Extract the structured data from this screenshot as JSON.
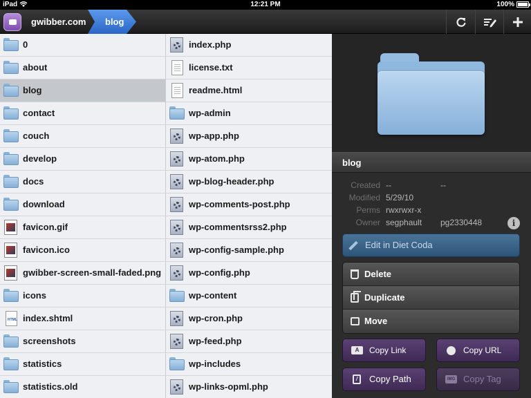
{
  "status": {
    "device": "iPad",
    "time": "12:21 PM",
    "battery": "100%",
    "battery_level": 1.0
  },
  "breadcrumb": {
    "site": "gwibber.com",
    "folder": "blog"
  },
  "toolbar": {
    "icons": [
      "refresh-icon",
      "edit-list-icon",
      "add-icon"
    ]
  },
  "files_col1": [
    {
      "name": "0",
      "type": "folder"
    },
    {
      "name": "about",
      "type": "folder"
    },
    {
      "name": "blog",
      "type": "folder",
      "selected": true
    },
    {
      "name": "contact",
      "type": "folder"
    },
    {
      "name": "couch",
      "type": "folder"
    },
    {
      "name": "develop",
      "type": "folder"
    },
    {
      "name": "docs",
      "type": "folder"
    },
    {
      "name": "download",
      "type": "folder"
    },
    {
      "name": "favicon.gif",
      "type": "image"
    },
    {
      "name": "favicon.ico",
      "type": "image"
    },
    {
      "name": "gwibber-screen-small-faded.png",
      "type": "image"
    },
    {
      "name": "icons",
      "type": "folder"
    },
    {
      "name": "index.shtml",
      "type": "html"
    },
    {
      "name": "screenshots",
      "type": "folder"
    },
    {
      "name": "statistics",
      "type": "folder"
    },
    {
      "name": "statistics.old",
      "type": "folder"
    }
  ],
  "files_col2": [
    {
      "name": "index.php",
      "type": "php"
    },
    {
      "name": "license.txt",
      "type": "doc"
    },
    {
      "name": "readme.html",
      "type": "doc"
    },
    {
      "name": "wp-admin",
      "type": "folder"
    },
    {
      "name": "wp-app.php",
      "type": "php"
    },
    {
      "name": "wp-atom.php",
      "type": "php"
    },
    {
      "name": "wp-blog-header.php",
      "type": "php"
    },
    {
      "name": "wp-comments-post.php",
      "type": "php"
    },
    {
      "name": "wp-commentsrss2.php",
      "type": "php"
    },
    {
      "name": "wp-config-sample.php",
      "type": "php"
    },
    {
      "name": "wp-config.php",
      "type": "php"
    },
    {
      "name": "wp-content",
      "type": "folder"
    },
    {
      "name": "wp-cron.php",
      "type": "php"
    },
    {
      "name": "wp-feed.php",
      "type": "php"
    },
    {
      "name": "wp-includes",
      "type": "folder"
    },
    {
      "name": "wp-links-opml.php",
      "type": "php"
    }
  ],
  "inspector": {
    "name": "blog",
    "meta": [
      {
        "label": "Created",
        "value": "--",
        "value2": "--"
      },
      {
        "label": "Modified",
        "value": "5/29/10",
        "value2": ""
      },
      {
        "label": "Perms",
        "value": "rwxrwxr-x",
        "value2": ""
      },
      {
        "label": "Owner",
        "value": "segphault",
        "value2": "pg2330448"
      }
    ],
    "info_glyph": "i",
    "edit_label": "Edit in Diet Coda",
    "actions": [
      "Delete",
      "Duplicate",
      "Move"
    ],
    "copy": {
      "link": "Copy Link",
      "link_badge": "A",
      "url": "Copy URL",
      "path": "Copy Path",
      "path_badge": "/",
      "tag": "Copy Tag",
      "tag_badge": "IMG"
    }
  }
}
